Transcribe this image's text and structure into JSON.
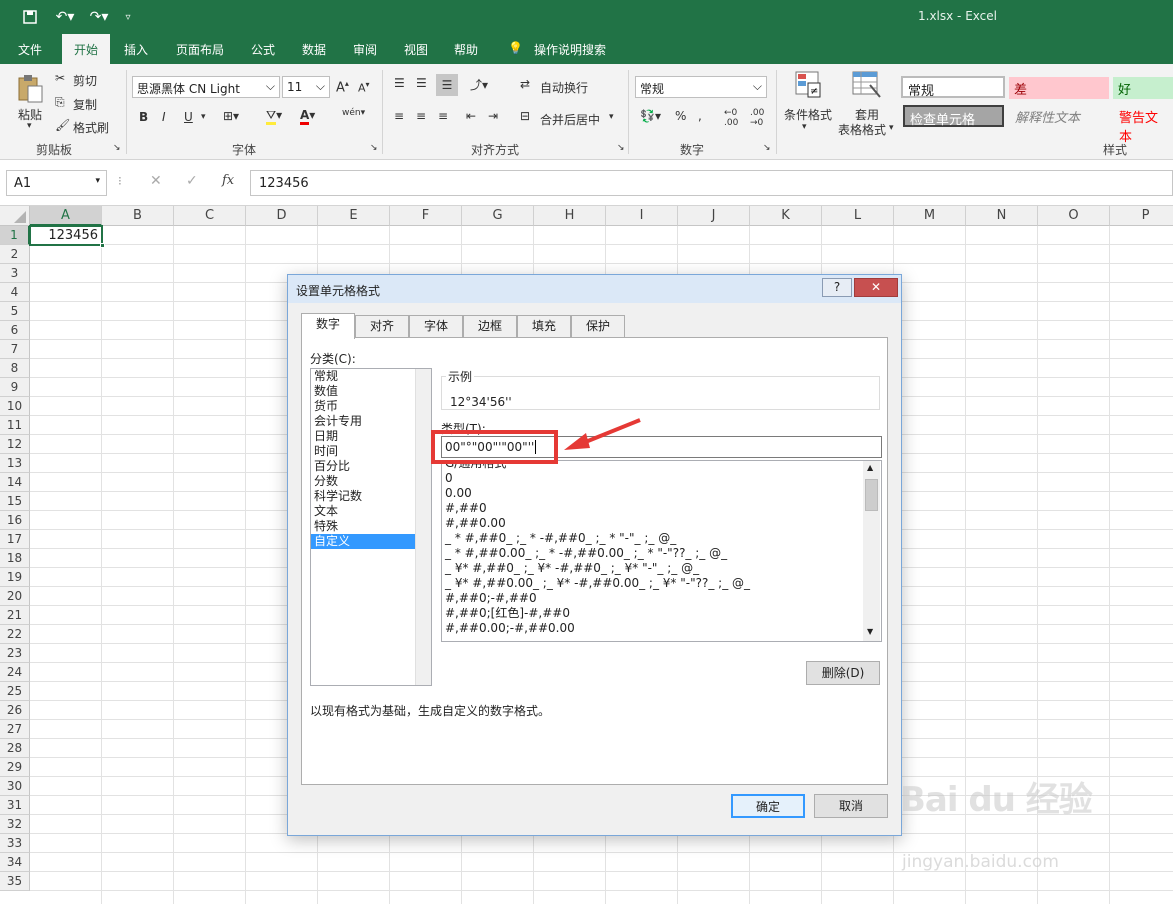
{
  "window": {
    "file_title": "1.xlsx  -  Excel"
  },
  "menu": {
    "file": "文件",
    "home": "开始",
    "insert": "插入",
    "page_layout": "页面布局",
    "formulas": "公式",
    "data": "数据",
    "review": "审阅",
    "view": "视图",
    "help": "帮助",
    "tell_me": "操作说明搜索"
  },
  "ribbon": {
    "paste": "粘贴",
    "cut": "剪切",
    "copy": "复制",
    "format_painter": "格式刷",
    "clipboard": "剪贴板",
    "font_name": "思源黑体 CN Light",
    "font_size": "11",
    "font_group": "字体",
    "bold": "B",
    "italic": "I",
    "underline": "U",
    "wen": "wén",
    "wrap_text": "自动换行",
    "merge_center": "合并后居中",
    "alignment": "对齐方式",
    "number_format": "常规",
    "number": "数字",
    "conditional": "条件格式",
    "table_format_1": "套用",
    "table_format_2": "表格格式",
    "style_normal": "常规",
    "style_bad": "差",
    "style_good": "好",
    "style_check": "检查单元格",
    "style_explanatory": "解释性文本",
    "style_warning": "警告文本",
    "styles": "样式"
  },
  "formula_bar": {
    "name_box": "A1",
    "fx": "fx",
    "value": "123456"
  },
  "grid": {
    "columns": [
      "A",
      "B",
      "C",
      "D",
      "E",
      "F",
      "G",
      "H",
      "I",
      "J",
      "K",
      "L",
      "M",
      "N",
      "O",
      "P"
    ],
    "rows": [
      "1",
      "2",
      "3",
      "4",
      "5",
      "6",
      "7",
      "8",
      "9",
      "10",
      "11",
      "12",
      "13",
      "14",
      "15",
      "16",
      "17",
      "18",
      "19",
      "20",
      "21",
      "22",
      "23",
      "24",
      "25",
      "26",
      "27",
      "28",
      "29",
      "30",
      "31",
      "32",
      "33",
      "34",
      "35"
    ],
    "a1_value": "123456"
  },
  "dialog": {
    "title": "设置单元格格式",
    "help": "?",
    "close": "✕",
    "tabs": [
      "数字",
      "对齐",
      "字体",
      "边框",
      "填充",
      "保护"
    ],
    "category_label": "分类(C):",
    "categories": [
      "常规",
      "数值",
      "货币",
      "会计专用",
      "日期",
      "时间",
      "百分比",
      "分数",
      "科学记数",
      "文本",
      "特殊",
      "自定义"
    ],
    "sample_label": "示例",
    "sample_value": "12°34'56''",
    "type_label": "类型(T):",
    "type_value": "00\"°\"00\"'\"00\"''",
    "formats": [
      "G/通用格式",
      "0",
      "0.00",
      "#,##0",
      "#,##0.00",
      "_ * #,##0_ ;_ * -#,##0_ ;_ * \"-\"_ ;_ @_",
      "_ * #,##0.00_ ;_ * -#,##0.00_ ;_ * \"-\"??_ ;_ @_",
      "_ ¥* #,##0_ ;_ ¥* -#,##0_ ;_ ¥* \"-\"_ ;_ @_",
      "_ ¥* #,##0.00_ ;_ ¥* -#,##0.00_ ;_ ¥* \"-\"??_ ;_ @_",
      "#,##0;-#,##0",
      "#,##0;[红色]-#,##0",
      "#,##0.00;-#,##0.00"
    ],
    "delete_btn": "删除(D)",
    "hint": "以现有格式为基础，生成自定义的数字格式。",
    "ok": "确定",
    "cancel": "取消"
  },
  "watermark": {
    "brand": "Bai du 经验",
    "url": "jingyan.baidu.com"
  }
}
